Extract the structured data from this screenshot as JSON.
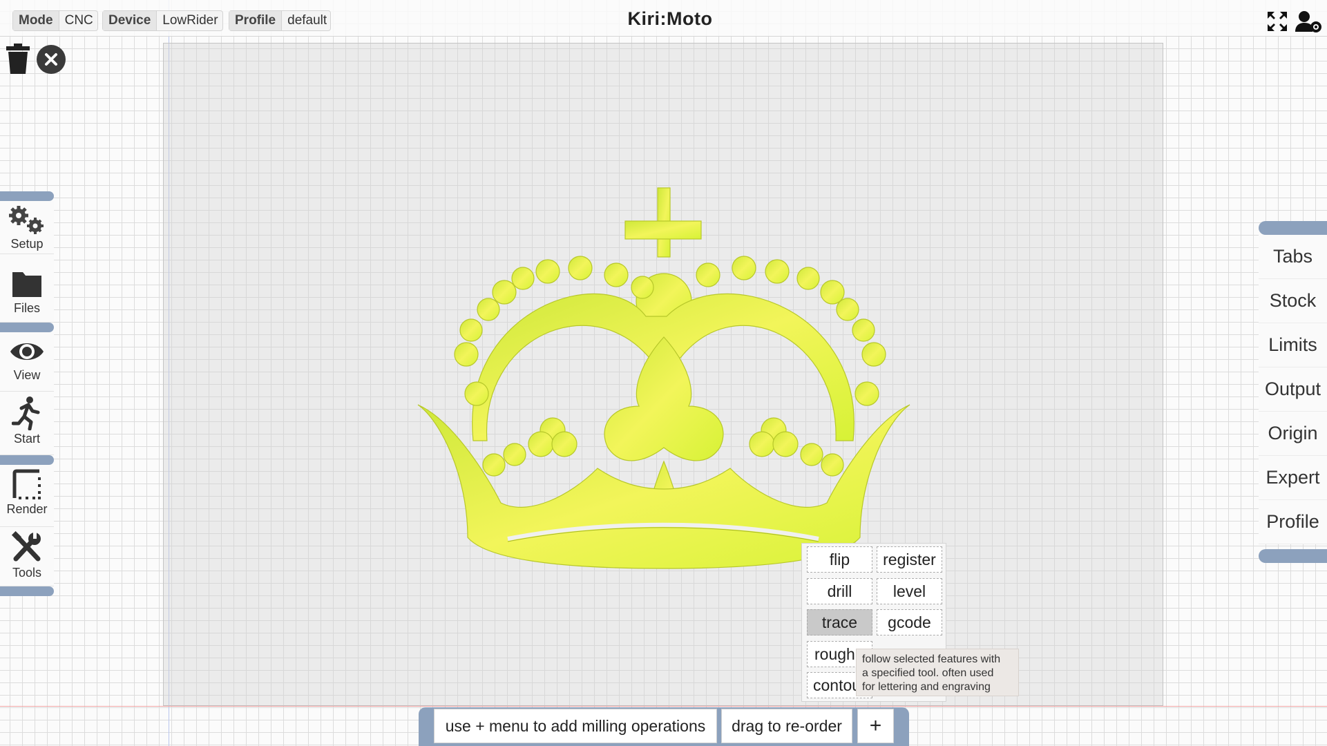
{
  "app": {
    "title": "Kiri:Moto"
  },
  "header": {
    "mode": {
      "label": "Mode",
      "value": "CNC"
    },
    "device": {
      "label": "Device",
      "value": "LowRider"
    },
    "profile": {
      "label": "Profile",
      "value": "default"
    },
    "icons": [
      "fullscreen-icon",
      "user-settings-icon"
    ]
  },
  "workspace": {
    "icons": [
      "trash-icon",
      "close-icon"
    ]
  },
  "left_toolbar": {
    "items": [
      {
        "label": "Setup",
        "icon": "gears-icon"
      },
      {
        "label": "Files",
        "icon": "folder-icon"
      },
      {
        "label": "View",
        "icon": "eye-icon"
      },
      {
        "label": "Start",
        "icon": "running-figure-icon"
      },
      {
        "label": "Render",
        "icon": "render-frame-icon"
      },
      {
        "label": "Tools",
        "icon": "tools-icon"
      }
    ]
  },
  "right_toolbar": {
    "items": [
      {
        "label": "Tabs"
      },
      {
        "label": "Stock"
      },
      {
        "label": "Limits"
      },
      {
        "label": "Output"
      },
      {
        "label": "Origin"
      },
      {
        "label": "Expert"
      },
      {
        "label": "Profile"
      }
    ]
  },
  "ops_menu": {
    "items": [
      {
        "label": "flip"
      },
      {
        "label": "register"
      },
      {
        "label": "drill"
      },
      {
        "label": "level"
      },
      {
        "label": "trace",
        "selected": true
      },
      {
        "label": "gcode"
      },
      {
        "label": "rough"
      },
      {
        "label": "contour"
      }
    ],
    "tooltip": {
      "lines": [
        "follow selected features with",
        "a specified tool. often used",
        "for lettering and engraving"
      ]
    }
  },
  "bottom_bar": {
    "hint": "use + menu to add milling operations",
    "reorder": "drag to re-order",
    "add": "+"
  },
  "model": {
    "name": "crown",
    "color": "#e6f542"
  }
}
